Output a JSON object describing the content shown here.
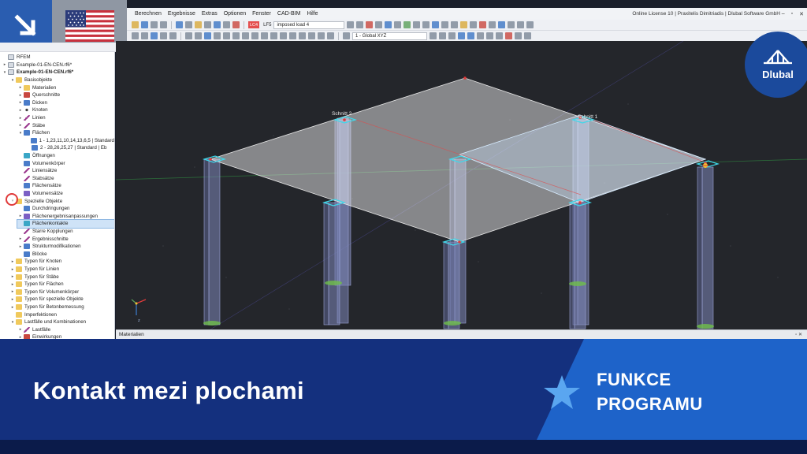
{
  "menu": [
    "Berechnen",
    "Ergebnisse",
    "Extras",
    "Optionen",
    "Fenster",
    "CAD-BIM",
    "Hilfe"
  ],
  "license_text": "Online License 10 | Praxitelis Dimitriadis | Dlubal Software GmbH",
  "toolbar": {
    "load_case_tag": "LC4",
    "load_case_code": "LF5",
    "load_case_name": "imposed load 4",
    "view_coord": "1 - Global XYZ"
  },
  "navigator": {
    "items": [
      {
        "label": "RFEM",
        "level": 0,
        "arrow": "",
        "icon": "file"
      },
      {
        "label": "Example-01-EN-CEN.rf6*",
        "level": 0,
        "arrow": "›",
        "icon": "file"
      },
      {
        "label": "Example-01-EN-CEN.rf6*",
        "level": 0,
        "arrow": "⌄",
        "icon": "file",
        "bold": true
      },
      {
        "label": "Basisobjekte",
        "level": 1,
        "arrow": "⌄",
        "icon": "folder"
      },
      {
        "label": "Materialien",
        "level": 2,
        "arrow": "›",
        "icon": "folder"
      },
      {
        "label": "Querschnitte",
        "level": 2,
        "arrow": "›",
        "icon": "red"
      },
      {
        "label": "Dicken",
        "level": 2,
        "arrow": "›",
        "icon": "blue"
      },
      {
        "label": "Knoten",
        "level": 2,
        "arrow": "›",
        "icon": "dot"
      },
      {
        "label": "Linien",
        "level": 2,
        "arrow": "›",
        "icon": "line"
      },
      {
        "label": "Stäbe",
        "level": 2,
        "arrow": "›",
        "icon": "line"
      },
      {
        "label": "Flächen",
        "level": 2,
        "arrow": "⌄",
        "icon": "blue"
      },
      {
        "label": "1 - 1,23,11,10,14,13,6,5 | Standard",
        "level": 3,
        "arrow": "",
        "icon": "blue"
      },
      {
        "label": "2 - 28,26,25,27 | Standard | Eb",
        "level": 3,
        "arrow": "",
        "icon": "blue"
      },
      {
        "label": "Öffnungen",
        "level": 2,
        "arrow": "",
        "icon": "cyan"
      },
      {
        "label": "Volumenkörper",
        "level": 2,
        "arrow": "",
        "icon": "blue"
      },
      {
        "label": "Liniensätze",
        "level": 2,
        "arrow": "",
        "icon": "line"
      },
      {
        "label": "Stabsätze",
        "level": 2,
        "arrow": "",
        "icon": "line"
      },
      {
        "label": "Flächensätze",
        "level": 2,
        "arrow": "",
        "icon": "blue"
      },
      {
        "label": "Volumensätze",
        "level": 2,
        "arrow": "",
        "icon": "purple"
      },
      {
        "label": "Spezielle Objekte",
        "level": 1,
        "arrow": "⌄",
        "icon": "folder"
      },
      {
        "label": "Durchdringungen",
        "level": 2,
        "arrow": "",
        "icon": "blue"
      },
      {
        "label": "Flächenergebnisanpassungen",
        "level": 2,
        "arrow": "›",
        "icon": "purple"
      },
      {
        "label": "Flächenkontakte",
        "level": 2,
        "arrow": "",
        "icon": "cyan",
        "selected": true
      },
      {
        "label": "Starre Kopplungen",
        "level": 2,
        "arrow": "",
        "icon": "line"
      },
      {
        "label": "Ergebnisschnitte",
        "level": 2,
        "arrow": "›",
        "icon": "line"
      },
      {
        "label": "Strukturmodifikationen",
        "level": 2,
        "arrow": "›",
        "icon": "blue"
      },
      {
        "label": "Blöcke",
        "level": 2,
        "arrow": "",
        "icon": "blue"
      },
      {
        "label": "Typen für Knoten",
        "level": 1,
        "arrow": "›",
        "icon": "folder"
      },
      {
        "label": "Typen für Linien",
        "level": 1,
        "arrow": "›",
        "icon": "folder"
      },
      {
        "label": "Typen für Stäbe",
        "level": 1,
        "arrow": "›",
        "icon": "folder"
      },
      {
        "label": "Typen für Flächen",
        "level": 1,
        "arrow": "›",
        "icon": "folder"
      },
      {
        "label": "Typen für Volumenkörper",
        "level": 1,
        "arrow": "›",
        "icon": "folder"
      },
      {
        "label": "Typen für spezielle Objekte",
        "level": 1,
        "arrow": "›",
        "icon": "folder"
      },
      {
        "label": "Typen für Betonbemessung",
        "level": 1,
        "arrow": "›",
        "icon": "folder"
      },
      {
        "label": "Imperfektionen",
        "level": 1,
        "arrow": "",
        "icon": "folder"
      },
      {
        "label": "Lastfälle und Kombinationen",
        "level": 1,
        "arrow": "⌄",
        "icon": "folder"
      },
      {
        "label": "Lastfälle",
        "level": 2,
        "arrow": "›",
        "icon": "line"
      },
      {
        "label": "Einwirkungen",
        "level": 2,
        "arrow": "›",
        "icon": "red"
      }
    ]
  },
  "viewport": {
    "section_label_1": "Schnitt 1",
    "section_label_2": "Schnitt 2"
  },
  "materials_panel_title": "Materialien",
  "logo_text": "Dlubal",
  "banner": {
    "title": "Kontakt mezi plochami",
    "sub_line1": "FUNKCE",
    "sub_line2": "PROGRAMU"
  },
  "colors": {
    "banner_dark": "#14307e",
    "banner_accent": "#1e63c9",
    "corner_blue": "#2a5db0",
    "logo": "#1b4a9c",
    "slab": "#ffffff"
  }
}
